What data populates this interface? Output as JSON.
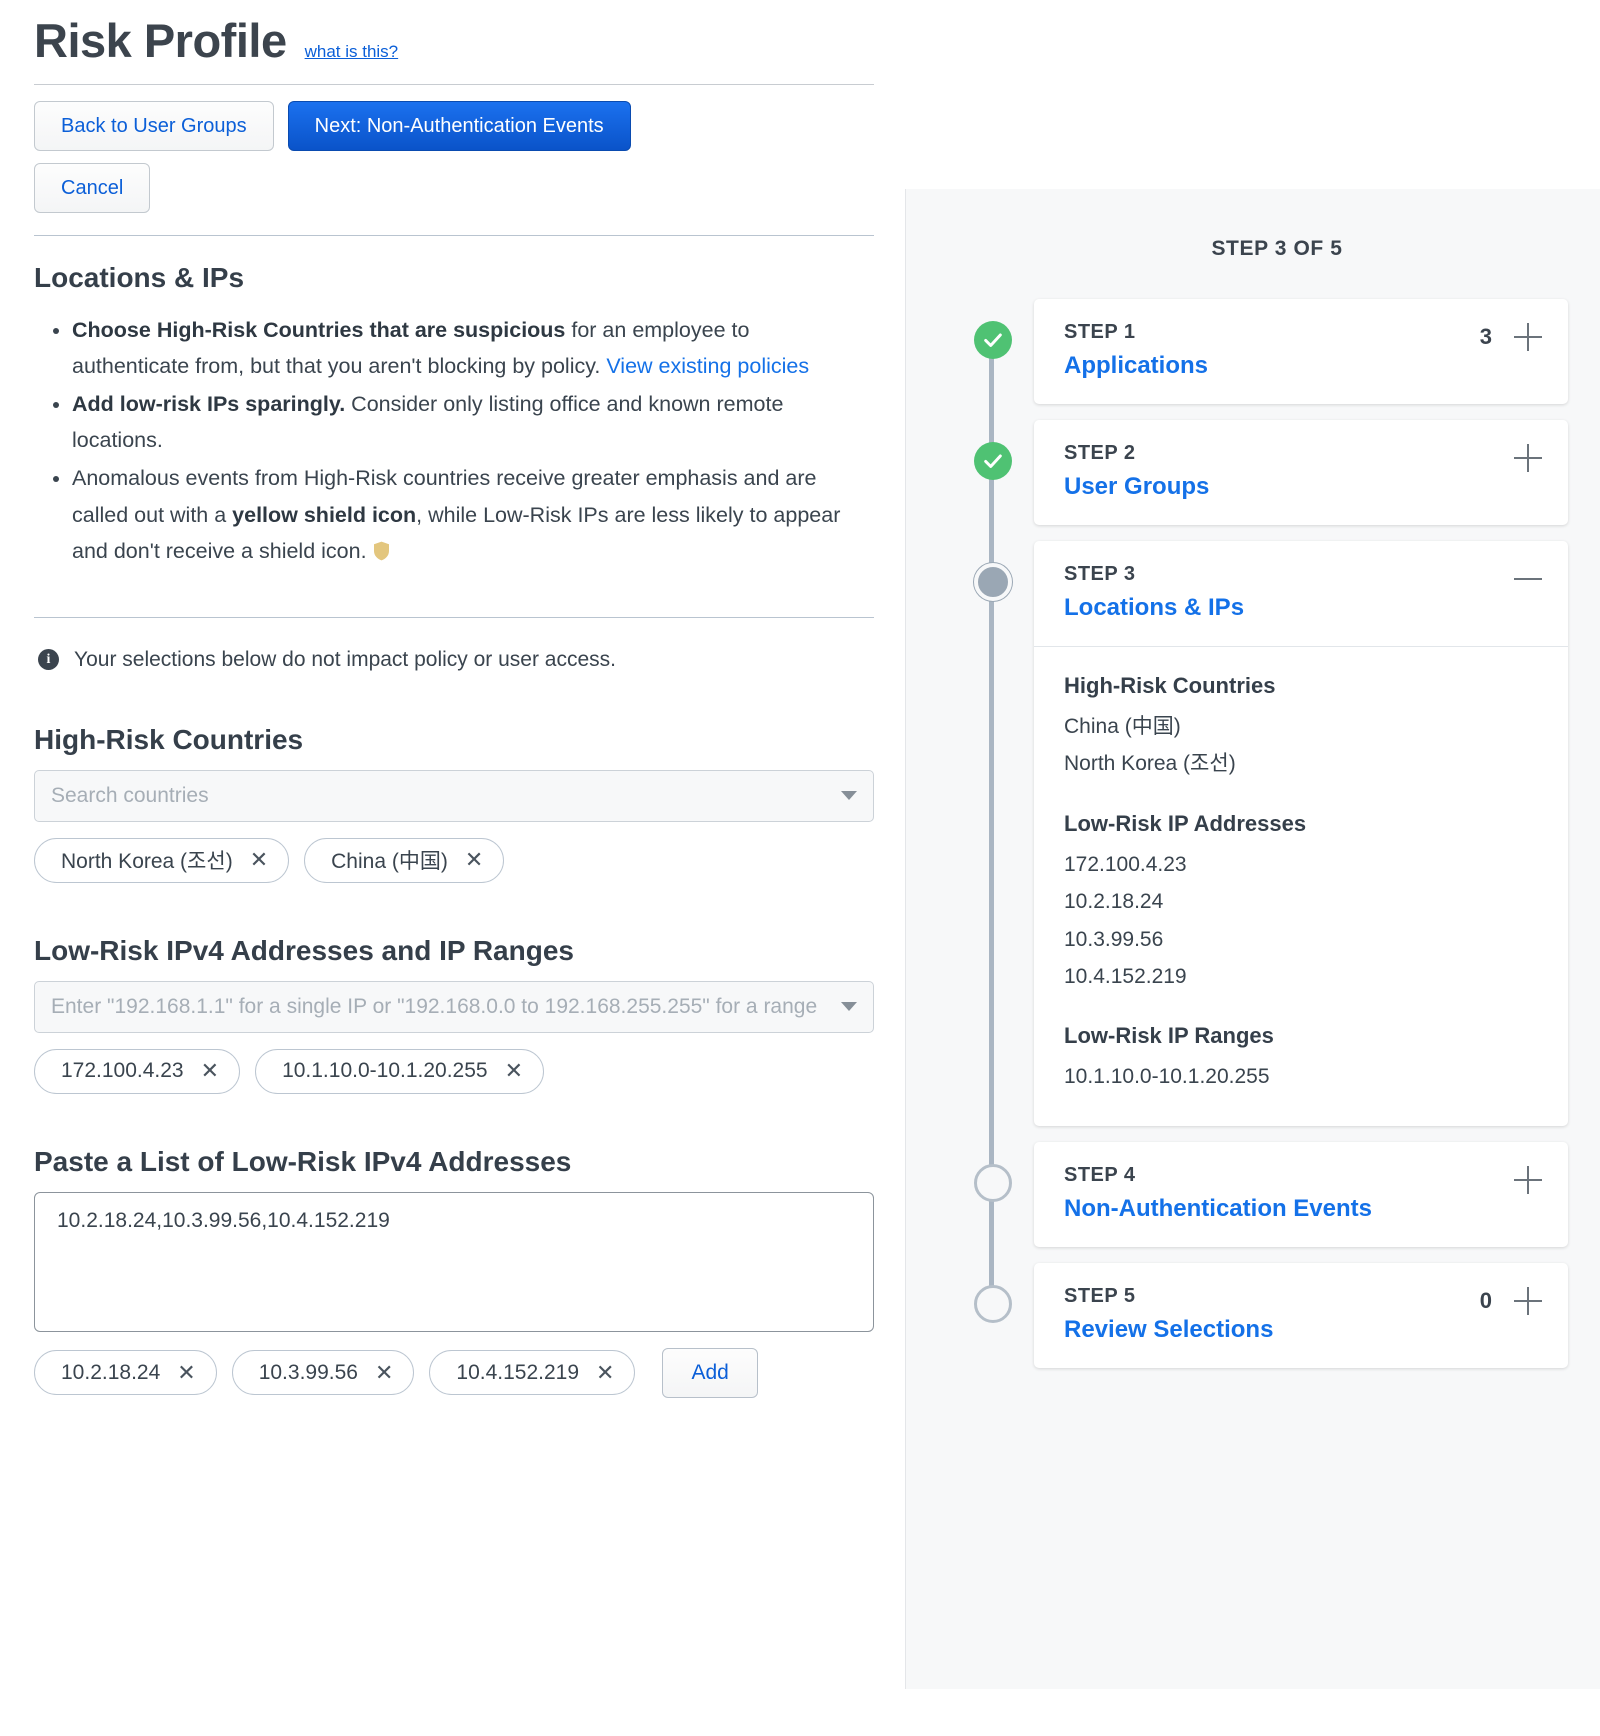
{
  "header": {
    "title": "Risk Profile",
    "help_link": "what is this?"
  },
  "actions": {
    "back": "Back to User Groups",
    "next": "Next: Non-Authentication Events",
    "cancel": "Cancel"
  },
  "main": {
    "section_title": "Locations & IPs",
    "bullets": [
      {
        "bold": "Choose High-Risk Countries that are suspicious",
        "rest": " for an employee to authenticate from, but that you aren't blocking by policy. ",
        "link": "View existing policies"
      },
      {
        "bold": "Add low-risk IPs sparingly.",
        "rest": " Consider only listing office and known remote locations."
      },
      {
        "pre": "Anomalous events from High-Risk countries receive greater emphasis and are called out with a ",
        "bold": "yellow shield icon",
        "post": ", while Low-Risk IPs are less likely to appear and don't receive a shield icon."
      }
    ],
    "info_note": "Your selections below do not impact policy or user access.",
    "countries": {
      "label": "High-Risk Countries",
      "placeholder": "Search countries",
      "chips": [
        "North Korea (조선)",
        "China (中国)"
      ]
    },
    "ips": {
      "label": "Low-Risk IPv4 Addresses and IP Ranges",
      "placeholder": "Enter \"192.168.1.1\" for a single IP or \"192.168.0.0 to 192.168.255.255\" for a range",
      "chips": [
        "172.100.4.23",
        "10.1.10.0-10.1.20.255"
      ]
    },
    "paste": {
      "label": "Paste a List of Low-Risk IPv4 Addresses",
      "value": "10.2.18.24,10.3.99.56,10.4.152.219",
      "chips": [
        "10.2.18.24",
        "10.3.99.56",
        "10.4.152.219"
      ],
      "add_label": "Add"
    }
  },
  "rail": {
    "step_of": "STEP 3 OF 5",
    "steps": [
      {
        "kicker": "STEP 1",
        "name": "Applications",
        "count": "3",
        "toggle": "plus",
        "state": "done"
      },
      {
        "kicker": "STEP 2",
        "name": "User Groups",
        "count": "",
        "toggle": "plus",
        "state": "done"
      },
      {
        "kicker": "STEP 3",
        "name": "Locations & IPs",
        "count": "",
        "toggle": "minus",
        "state": "current",
        "body": [
          {
            "title": "High-Risk Countries",
            "lines": [
              "China (中国)",
              "North Korea (조선)"
            ]
          },
          {
            "title": "Low-Risk IP Addresses",
            "lines": [
              "172.100.4.23",
              "10.2.18.24",
              "10.3.99.56",
              "10.4.152.219"
            ]
          },
          {
            "title": "Low-Risk IP Ranges",
            "lines": [
              "10.1.10.0-10.1.20.255"
            ]
          }
        ]
      },
      {
        "kicker": "STEP 4",
        "name": "Non-Authentication Events",
        "count": "",
        "toggle": "plus",
        "state": "pending"
      },
      {
        "kicker": "STEP 5",
        "name": "Review Selections",
        "count": "0",
        "toggle": "plus",
        "state": "pending"
      }
    ]
  },
  "colors": {
    "link": "#1471e8",
    "primary_button": "#0a53c9",
    "done_node": "#4fc273",
    "shield": "#e3c67e"
  }
}
